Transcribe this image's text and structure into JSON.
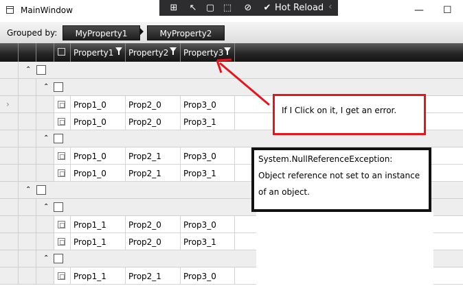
{
  "window": {
    "title": "MainWindow",
    "hot_reload": "Hot Reload",
    "minimize": "—",
    "maximize": "☐"
  },
  "group_panel": {
    "label": "Grouped by:",
    "chips": [
      "MyProperty1",
      "MyProperty2"
    ]
  },
  "columns": [
    "Property1",
    "Property2",
    "Property3"
  ],
  "rows": [
    {
      "p1": "Prop1_0",
      "p2": "Prop2_0",
      "p3": "Prop3_0"
    },
    {
      "p1": "Prop1_0",
      "p2": "Prop2_0",
      "p3": "Prop3_1"
    },
    {
      "p1": "Prop1_0",
      "p2": "Prop2_1",
      "p3": "Prop3_0"
    },
    {
      "p1": "Prop1_0",
      "p2": "Prop2_1",
      "p3": "Prop3_1"
    },
    {
      "p1": "Prop1_1",
      "p2": "Prop2_0",
      "p3": "Prop3_0"
    },
    {
      "p1": "Prop1_1",
      "p2": "Prop2_0",
      "p3": "Prop3_1"
    },
    {
      "p1": "Prop1_1",
      "p2": "Prop2_1",
      "p3": "Prop3_0"
    }
  ],
  "annotations": {
    "note1": "If I Click on it, I get an error.",
    "note2_line1": "System.NullReferenceException:",
    "note2_line2": "Object reference not set to an instance",
    "note2_line3": "of an object."
  },
  "colors": {
    "arrow": "#e8141b",
    "header": "#262626",
    "group_row": "#eeeeee"
  }
}
